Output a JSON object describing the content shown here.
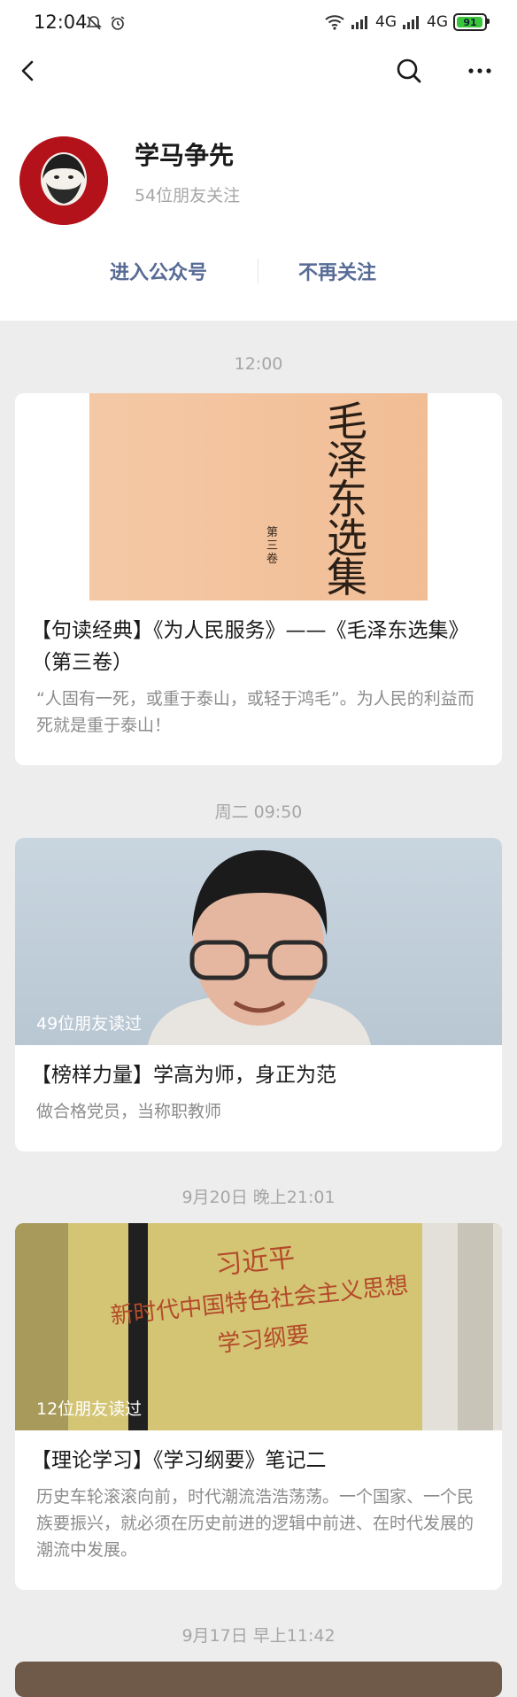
{
  "status_bar": {
    "time": "12:04",
    "network_1": "4G",
    "network_2": "4G",
    "battery": "91",
    "icons": [
      "mute-bell-icon",
      "alarm-icon",
      "wifi-icon",
      "signal-icon",
      "battery-icon"
    ]
  },
  "nav": {
    "icons": [
      "back-icon",
      "search-icon",
      "more-icon"
    ]
  },
  "account": {
    "name": "学马争先",
    "followers": "54位朋友关注",
    "enter_label": "进入公众号",
    "unfollow_label": "不再关注",
    "avatar_text": "学马争先"
  },
  "colors": {
    "background": "#ededed",
    "card": "#ffffff",
    "link": "#576b95",
    "muted": "#a6a6a6",
    "avatar_red": "#b3121a"
  },
  "articles": [
    {
      "timestamp": "12:00",
      "cover_text": [
        "毛",
        "泽",
        "东",
        "选",
        "集"
      ],
      "cover_volume": "第三卷",
      "readers": "",
      "title": "【句读经典】《为人民服务》——《毛泽东选集》（第三卷）",
      "desc": "“人固有一死，或重于泰山，或轻于鸿毛”。为人民的利益而死就是重于泰山！"
    },
    {
      "timestamp": "周二 09:50",
      "readers": "49位朋友读过",
      "title": "【榜样力量】学高为师，身正为范",
      "desc": "做合格党员，当称职教师"
    },
    {
      "timestamp": "9月20日 晚上21:01",
      "cover_lines": [
        "习近平",
        "新时代中国特色社会主义思想",
        "学习纲要"
      ],
      "readers": "12位朋友读过",
      "title": "【理论学习】《学习纲要》笔记二",
      "desc": "历史车轮滚滚向前，时代潮流浩浩荡荡。一个国家、一个民族要振兴，就必须在历史前进的逻辑中前进、在时代发展的潮流中发展。"
    },
    {
      "timestamp": "9月17日 早上11:42"
    }
  ]
}
